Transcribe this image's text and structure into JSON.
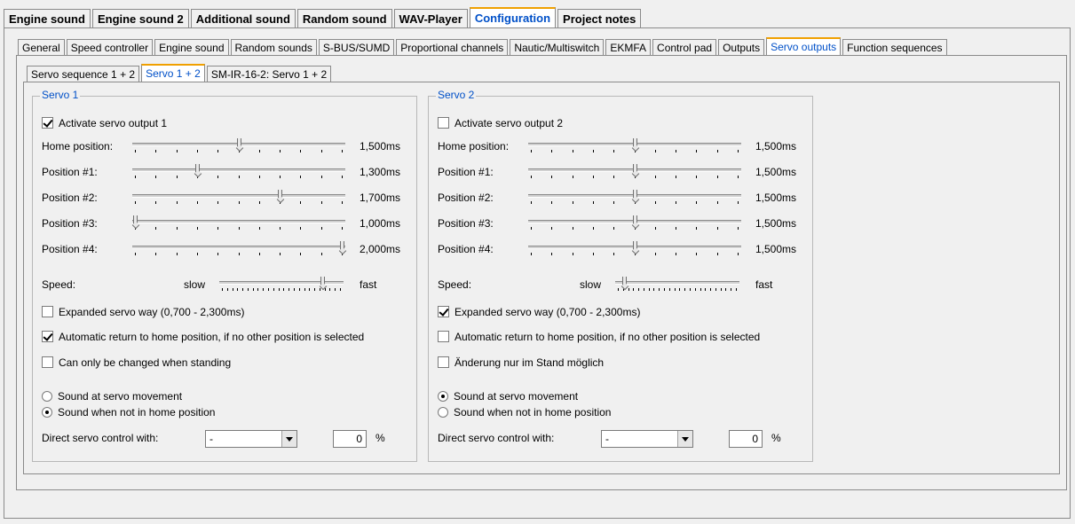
{
  "main_tabs": [
    "Engine sound",
    "Engine sound 2",
    "Additional sound",
    "Random sound",
    "WAV-Player",
    "Configuration",
    "Project notes"
  ],
  "main_tab_active": 5,
  "config_tabs": [
    "General",
    "Speed controller",
    "Engine sound",
    "Random sounds",
    "S-BUS/SUMD",
    "Proportional channels",
    "Nautic/Multiswitch",
    "EKMFA",
    "Control pad",
    "Outputs",
    "Servo outputs",
    "Function sequences"
  ],
  "config_tab_active": 10,
  "servo_tabs": [
    "Servo sequence  1 + 2",
    "Servo 1 + 2",
    "SM-IR-16-2: Servo 1 + 2"
  ],
  "servo_tab_active": 1,
  "servo1": {
    "title": "Servo 1",
    "activate_label": "Activate servo output 1",
    "activate_checked": true,
    "positions": [
      {
        "label": "Home position:",
        "value": "1,500ms",
        "ms": 1500
      },
      {
        "label": "Position #1:",
        "value": "1,300ms",
        "ms": 1300
      },
      {
        "label": "Position #2:",
        "value": "1,700ms",
        "ms": 1700
      },
      {
        "label": "Position #3:",
        "value": "1,000ms",
        "ms": 1000
      },
      {
        "label": "Position #4:",
        "value": "2,000ms",
        "ms": 2000
      }
    ],
    "speed_label": "Speed:",
    "speed_slow": "slow",
    "speed_fast": "fast",
    "speed_level": 0.85,
    "expanded_label": "Expanded servo way (0,700 - 2,300ms)",
    "expanded_checked": false,
    "auto_return_label": "Automatic return to home position, if no other position is selected",
    "auto_return_checked": true,
    "standing_label": "Can only be changed when standing",
    "standing_checked": false,
    "radio_movement_label": "Sound at servo movement",
    "radio_home_label": "Sound when not in home position",
    "radio_selected": "home",
    "direct_label": "Direct servo control with:",
    "direct_value": "-",
    "percent_value": "0",
    "percent_unit": "%"
  },
  "servo2": {
    "title": "Servo 2",
    "activate_label": "Activate servo output 2",
    "activate_checked": false,
    "positions": [
      {
        "label": "Home position:",
        "value": "1,500ms",
        "ms": 1500
      },
      {
        "label": "Position #1:",
        "value": "1,500ms",
        "ms": 1500
      },
      {
        "label": "Position #2:",
        "value": "1,500ms",
        "ms": 1500
      },
      {
        "label": "Position #3:",
        "value": "1,500ms",
        "ms": 1500
      },
      {
        "label": "Position #4:",
        "value": "1,500ms",
        "ms": 1500
      }
    ],
    "speed_label": "Speed:",
    "speed_slow": "slow",
    "speed_fast": "fast",
    "speed_level": 0.05,
    "expanded_label": "Expanded servo way (0,700 - 2,300ms)",
    "expanded_checked": true,
    "auto_return_label": "Automatic return to home position, if no other position is selected",
    "auto_return_checked": false,
    "standing_label": "Änderung nur im Stand möglich",
    "standing_checked": false,
    "radio_movement_label": "Sound at servo movement",
    "radio_home_label": "Sound when not in home position",
    "radio_selected": "movement",
    "direct_label": "Direct servo control with:",
    "direct_value": "-",
    "percent_value": "0",
    "percent_unit": "%"
  }
}
